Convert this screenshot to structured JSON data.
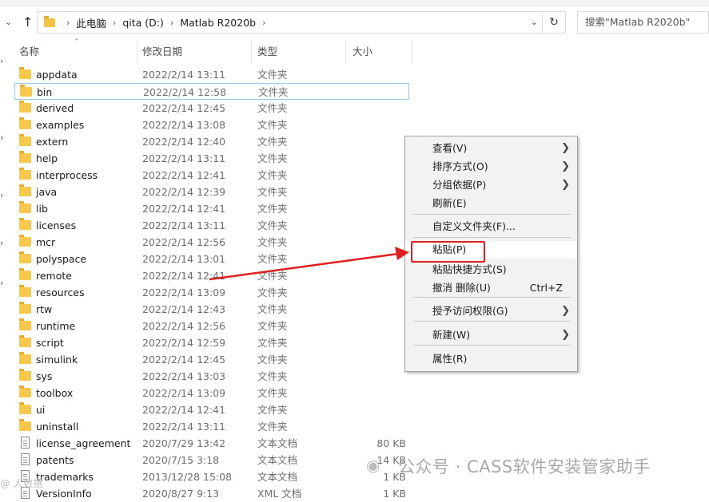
{
  "address": {
    "crumbs": [
      "此电脑",
      "qita (D:)",
      "Matlab R2020b"
    ],
    "search_placeholder": "搜索\"Matlab R2020b\""
  },
  "columns": {
    "name": "名称",
    "date": "修改日期",
    "type": "类型",
    "size": "大小"
  },
  "files": [
    {
      "name": "appdata",
      "date": "2022/2/14 13:11",
      "type": "文件夹",
      "size": "",
      "kind": "folder"
    },
    {
      "name": "bin",
      "date": "2022/2/14 12:58",
      "type": "文件夹",
      "size": "",
      "kind": "folder"
    },
    {
      "name": "derived",
      "date": "2022/2/14 12:45",
      "type": "文件夹",
      "size": "",
      "kind": "folder"
    },
    {
      "name": "examples",
      "date": "2022/2/14 13:08",
      "type": "文件夹",
      "size": "",
      "kind": "folder"
    },
    {
      "name": "extern",
      "date": "2022/2/14 12:40",
      "type": "文件夹",
      "size": "",
      "kind": "folder"
    },
    {
      "name": "help",
      "date": "2022/2/14 13:11",
      "type": "文件夹",
      "size": "",
      "kind": "folder"
    },
    {
      "name": "interprocess",
      "date": "2022/2/14 12:41",
      "type": "文件夹",
      "size": "",
      "kind": "folder"
    },
    {
      "name": "java",
      "date": "2022/2/14 12:39",
      "type": "文件夹",
      "size": "",
      "kind": "folder"
    },
    {
      "name": "lib",
      "date": "2022/2/14 12:41",
      "type": "文件夹",
      "size": "",
      "kind": "folder"
    },
    {
      "name": "licenses",
      "date": "2022/2/14 13:11",
      "type": "文件夹",
      "size": "",
      "kind": "folder"
    },
    {
      "name": "mcr",
      "date": "2022/2/14 12:56",
      "type": "文件夹",
      "size": "",
      "kind": "folder"
    },
    {
      "name": "polyspace",
      "date": "2022/2/14 13:01",
      "type": "文件夹",
      "size": "",
      "kind": "folder"
    },
    {
      "name": "remote",
      "date": "2022/2/14 12:41",
      "type": "文件夹",
      "size": "",
      "kind": "folder"
    },
    {
      "name": "resources",
      "date": "2022/2/14 13:09",
      "type": "文件夹",
      "size": "",
      "kind": "folder"
    },
    {
      "name": "rtw",
      "date": "2022/2/14 12:43",
      "type": "文件夹",
      "size": "",
      "kind": "folder"
    },
    {
      "name": "runtime",
      "date": "2022/2/14 12:56",
      "type": "文件夹",
      "size": "",
      "kind": "folder"
    },
    {
      "name": "script",
      "date": "2022/2/14 12:59",
      "type": "文件夹",
      "size": "",
      "kind": "folder"
    },
    {
      "name": "simulink",
      "date": "2022/2/14 12:45",
      "type": "文件夹",
      "size": "",
      "kind": "folder"
    },
    {
      "name": "sys",
      "date": "2022/2/14 13:03",
      "type": "文件夹",
      "size": "",
      "kind": "folder"
    },
    {
      "name": "toolbox",
      "date": "2022/2/14 13:09",
      "type": "文件夹",
      "size": "",
      "kind": "folder"
    },
    {
      "name": "ui",
      "date": "2022/2/14 12:41",
      "type": "文件夹",
      "size": "",
      "kind": "folder"
    },
    {
      "name": "uninstall",
      "date": "2022/2/14 13:11",
      "type": "文件夹",
      "size": "",
      "kind": "folder"
    },
    {
      "name": "license_agreement",
      "date": "2020/7/29 13:42",
      "type": "文本文档",
      "size": "80 KB",
      "kind": "doc"
    },
    {
      "name": "patents",
      "date": "2020/7/15 3:18",
      "type": "文本文档",
      "size": "14 KB",
      "kind": "doc"
    },
    {
      "name": "trademarks",
      "date": "2013/12/28 15:08",
      "type": "文本文档",
      "size": "1 KB",
      "kind": "doc"
    },
    {
      "name": "VersionInfo",
      "date": "2020/8/27 9:13",
      "type": "XML 文档",
      "size": "1 KB",
      "kind": "doc"
    }
  ],
  "selected_row": "bin",
  "context_menu": {
    "items": [
      {
        "label": "查看(V)",
        "submenu": true
      },
      {
        "label": "排序方式(O)",
        "submenu": true
      },
      {
        "label": "分组依据(P)",
        "submenu": true
      },
      {
        "label": "刷新(E)",
        "submenu": false
      },
      {
        "label": "自定义文件夹(F)...",
        "submenu": false
      },
      {
        "label": "粘贴(P)",
        "submenu": false
      },
      {
        "label": "粘贴快捷方式(S)",
        "submenu": false
      },
      {
        "label": "撤消 删除(U)",
        "submenu": false,
        "shortcut": "Ctrl+Z"
      },
      {
        "label": "授予访问权限(G)",
        "submenu": true
      },
      {
        "label": "新建(W)",
        "submenu": true
      },
      {
        "label": "属性(R)",
        "submenu": false
      }
    ],
    "highlighted": "粘贴(P)"
  },
  "annotation": {
    "box_color": "#e02020",
    "arrow_color": "#e02020"
  },
  "watermark": {
    "text": "公众号 · CASS软件安装管家助手",
    "corner_text": "@ 人数据"
  },
  "icons": {
    "back": "chevron-icon",
    "up": "up-arrow-icon",
    "address_folder": "folder-icon",
    "dropdown": "chevron-down-icon",
    "refresh": "refresh-icon",
    "folder": "folder-icon",
    "document": "document-icon",
    "submenu": "chevron-right-icon"
  }
}
